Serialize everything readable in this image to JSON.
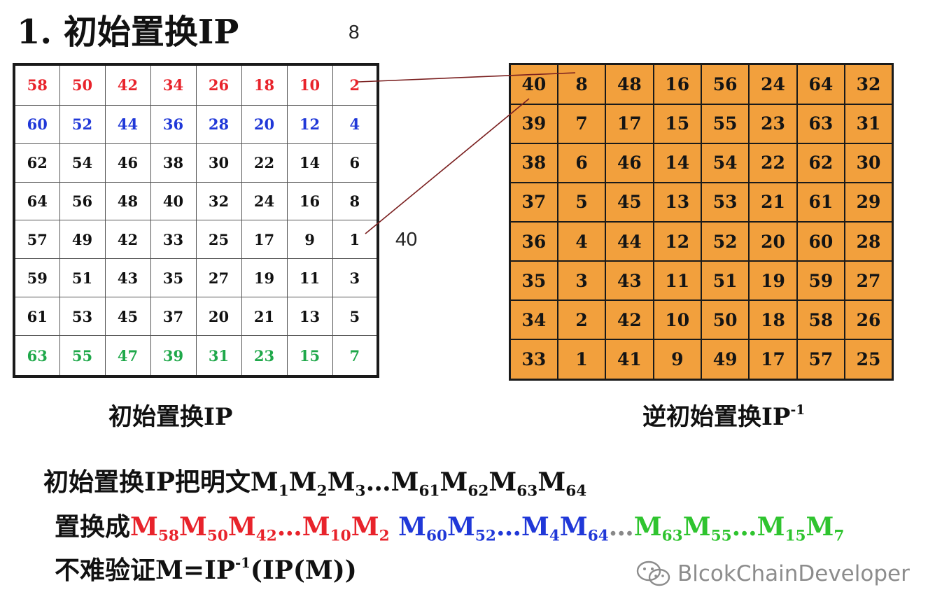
{
  "title": "1. 初始置换IP",
  "annotations": {
    "top_note": "8",
    "mid_note": "40"
  },
  "ip_table": {
    "caption": "初始置换IP",
    "rows": [
      [
        "58",
        "50",
        "42",
        "34",
        "26",
        "18",
        "10",
        "2"
      ],
      [
        "60",
        "52",
        "44",
        "36",
        "28",
        "20",
        "12",
        "4"
      ],
      [
        "62",
        "54",
        "46",
        "38",
        "30",
        "22",
        "14",
        "6"
      ],
      [
        "64",
        "56",
        "48",
        "40",
        "32",
        "24",
        "16",
        "8"
      ],
      [
        "57",
        "49",
        "42",
        "33",
        "25",
        "17",
        "9",
        "1"
      ],
      [
        "59",
        "51",
        "43",
        "35",
        "27",
        "19",
        "11",
        "3"
      ],
      [
        "61",
        "53",
        "45",
        "37",
        "20",
        "21",
        "13",
        "5"
      ],
      [
        "63",
        "55",
        "47",
        "39",
        "31",
        "23",
        "15",
        "7"
      ]
    ],
    "row_colors": [
      "#e8232b",
      "#2038d8",
      "#111111",
      "#111111",
      "#111111",
      "#111111",
      "#111111",
      "#1fa84a"
    ]
  },
  "ip_inverse_table": {
    "caption": "逆初始置换IP",
    "caption_sup": "-1",
    "rows": [
      [
        "40",
        "8",
        "48",
        "16",
        "56",
        "24",
        "64",
        "32"
      ],
      [
        "39",
        "7",
        "17",
        "15",
        "55",
        "23",
        "63",
        "31"
      ],
      [
        "38",
        "6",
        "46",
        "14",
        "54",
        "22",
        "62",
        "30"
      ],
      [
        "37",
        "5",
        "45",
        "13",
        "53",
        "21",
        "61",
        "29"
      ],
      [
        "36",
        "4",
        "44",
        "12",
        "52",
        "20",
        "60",
        "28"
      ],
      [
        "35",
        "3",
        "43",
        "11",
        "51",
        "19",
        "59",
        "27"
      ],
      [
        "34",
        "2",
        "42",
        "10",
        "50",
        "18",
        "58",
        "26"
      ],
      [
        "33",
        "1",
        "41",
        "9",
        "49",
        "17",
        "57",
        "25"
      ]
    ],
    "cell_color": "#f2a03d"
  },
  "text_lines": {
    "line1": [
      {
        "t": "初始置换IP把明文M"
      },
      {
        "sub": "1"
      },
      {
        "t": "M"
      },
      {
        "sub": "2"
      },
      {
        "t": "M"
      },
      {
        "sub": "3"
      },
      {
        "t": "…M"
      },
      {
        "sub": "61"
      },
      {
        "t": "M"
      },
      {
        "sub": "62"
      },
      {
        "t": "M"
      },
      {
        "sub": "63"
      },
      {
        "t": "M"
      },
      {
        "sub": "64"
      }
    ],
    "line2": [
      {
        "t": "置换成"
      },
      {
        "t": "M",
        "color": "#e8232b"
      },
      {
        "sub": "58",
        "color": "#e8232b"
      },
      {
        "t": "M",
        "color": "#e8232b"
      },
      {
        "sub": "50",
        "color": "#e8232b"
      },
      {
        "t": "M",
        "color": "#e8232b"
      },
      {
        "sub": "42",
        "color": "#e8232b"
      },
      {
        "t": "…M",
        "color": "#e8232b"
      },
      {
        "sub": "10",
        "color": "#e8232b"
      },
      {
        "t": "M",
        "color": "#e8232b"
      },
      {
        "sub": "2",
        "color": "#e8232b"
      },
      {
        "t": " M",
        "color": "#2038d8"
      },
      {
        "sub": "60",
        "color": "#2038d8"
      },
      {
        "t": "M",
        "color": "#2038d8"
      },
      {
        "sub": "52",
        "color": "#2038d8"
      },
      {
        "t": "…M",
        "color": "#2038d8"
      },
      {
        "sub": "4",
        "color": "#2038d8"
      },
      {
        "t": "M",
        "color": "#2038d8"
      },
      {
        "sub": "64",
        "color": "#2038d8"
      },
      {
        "t": "…",
        "color": "#888888"
      },
      {
        "t": "M",
        "color": "#2fc42f"
      },
      {
        "sub": "63",
        "color": "#2fc42f"
      },
      {
        "t": "M",
        "color": "#2fc42f"
      },
      {
        "sub": "55",
        "color": "#2fc42f"
      },
      {
        "t": "…M",
        "color": "#2fc42f"
      },
      {
        "sub": "15",
        "color": "#2fc42f"
      },
      {
        "t": "M",
        "color": "#2fc42f"
      },
      {
        "sub": "7",
        "color": "#2fc42f"
      }
    ],
    "line3": [
      {
        "t": "不难验证M=IP"
      },
      {
        "sup": "-1"
      },
      {
        "t": "(IP(M))"
      }
    ]
  },
  "watermark": {
    "icon": "wechat-icon",
    "text": "BlcokChainDeveloper"
  },
  "colors": {
    "connector_line": "#7a1f1f",
    "watermark": "#8c8c8c"
  }
}
